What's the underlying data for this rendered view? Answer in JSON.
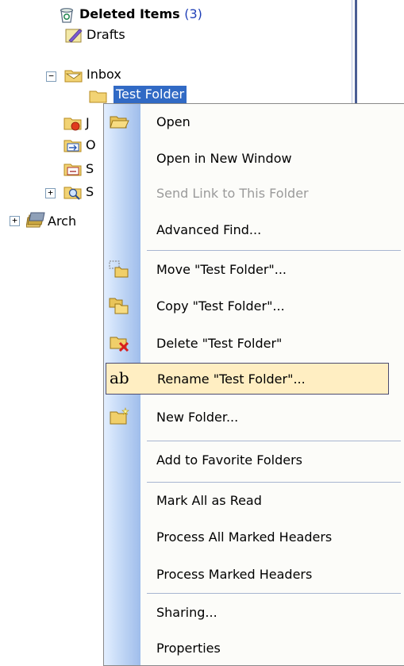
{
  "folder_tree": {
    "deleted_items": {
      "label": "Deleted Items",
      "count": "(3)"
    },
    "drafts": {
      "label": "Drafts"
    },
    "inbox": {
      "label": "Inbox",
      "expander": "−"
    },
    "test_folder": {
      "label": "Test Folder"
    },
    "partial_items": [
      {
        "label": "J"
      },
      {
        "label": "O"
      },
      {
        "label": "S"
      },
      {
        "label": "S",
        "expander": "+"
      }
    ],
    "archive": {
      "label": "Arch",
      "expander": "+"
    }
  },
  "context_menu": {
    "items": [
      {
        "label": "Open",
        "icon": "open-folder-icon"
      },
      {
        "label": "Open in New Window"
      },
      {
        "label": "Send Link to This Folder",
        "disabled": true
      },
      {
        "label": "Advanced Find..."
      },
      {
        "label": "Move \"Test Folder\"...",
        "icon": "move-folder-icon"
      },
      {
        "label": "Copy \"Test Folder\"...",
        "icon": "copy-folder-icon"
      },
      {
        "label": "Delete \"Test Folder\"",
        "icon": "delete-folder-icon"
      },
      {
        "label": "Rename \"Test Folder\"...",
        "icon": "rename-icon",
        "icon_text": "ab",
        "highlighted": true
      },
      {
        "label": "New Folder...",
        "icon": "new-folder-icon"
      },
      {
        "label": "Add to Favorite Folders"
      },
      {
        "label": "Mark All as Read"
      },
      {
        "label": "Process All Marked Headers"
      },
      {
        "label": "Process Marked Headers"
      },
      {
        "label": "Sharing..."
      },
      {
        "label": "Properties"
      }
    ]
  },
  "colors": {
    "selection": "#316ac5",
    "menu_highlight": "#ffeec2",
    "gutter": "#c7dbf7",
    "count_text": "#1f3fb7"
  }
}
